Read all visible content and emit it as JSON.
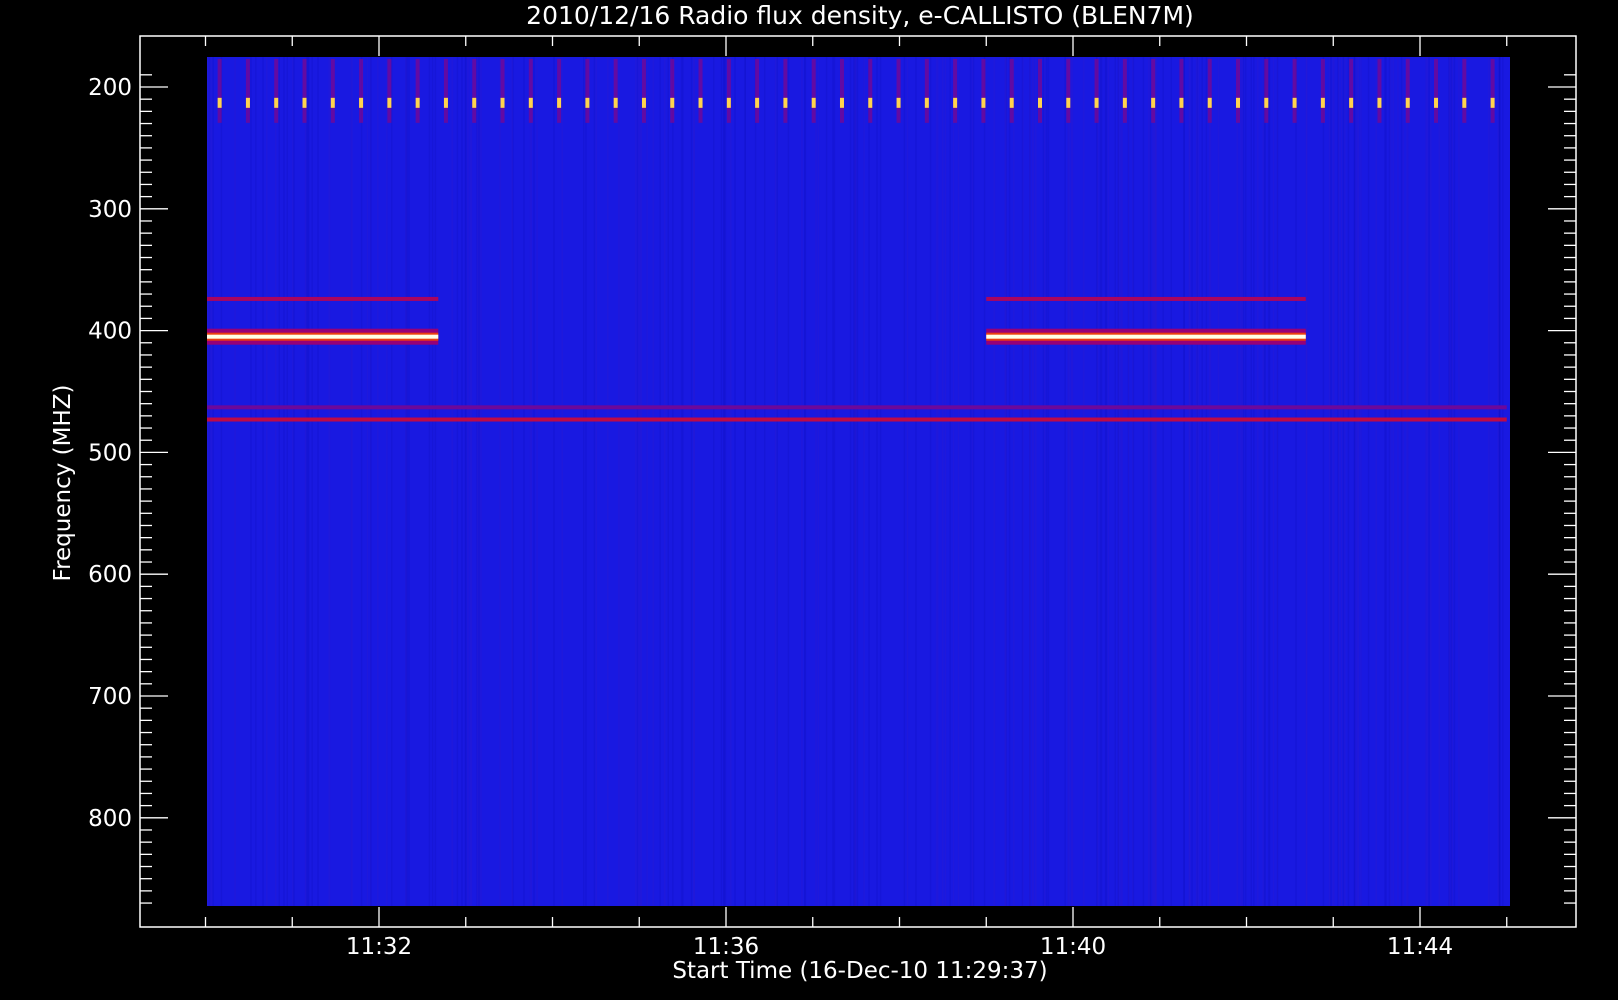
{
  "chart_data": {
    "type": "heatmap",
    "title": "2010/12/16  Radio flux density, e-CALLISTO (BLEN7M)",
    "xlabel": "Start Time (16-Dec-10 11:29:37)",
    "ylabel": "Frequency (MHZ)",
    "x_ticks": [
      "11:32",
      "11:36",
      "11:40",
      "11:44"
    ],
    "y_ticks": [
      "200",
      "300",
      "400",
      "500",
      "600",
      "700",
      "800"
    ],
    "x_range_minutes": [
      690.0,
      705.0
    ],
    "y_range_mhz": [
      180,
      875
    ],
    "y_direction": "inverted",
    "colormap": "blue-red-yellow-white",
    "background_level": 0.15,
    "features": [
      {
        "kind": "band",
        "freq_mhz": 405,
        "time_start": "11:30:00",
        "time_end": "11:32:41",
        "intensity": 1.0
      },
      {
        "kind": "band",
        "freq_mhz": 405,
        "time_start": "11:39:00",
        "time_end": "11:42:41",
        "intensity": 1.0
      },
      {
        "kind": "band",
        "freq_mhz": 374,
        "time_start": "11:30:00",
        "time_end": "11:32:41",
        "intensity": 0.5
      },
      {
        "kind": "band",
        "freq_mhz": 374,
        "time_start": "11:39:00",
        "time_end": "11:42:41",
        "intensity": 0.5
      },
      {
        "kind": "band",
        "freq_mhz": 473,
        "time_start": "11:30:00",
        "time_end": "11:45:00",
        "intensity": 0.55
      },
      {
        "kind": "band",
        "freq_mhz": 463,
        "time_start": "11:30:00",
        "time_end": "11:45:00",
        "intensity": 0.35
      },
      {
        "kind": "spikes",
        "freq_mhz": 213,
        "time_start": "11:30:00",
        "time_end": "11:45:00",
        "count": 46,
        "intensity": 0.9
      }
    ]
  }
}
